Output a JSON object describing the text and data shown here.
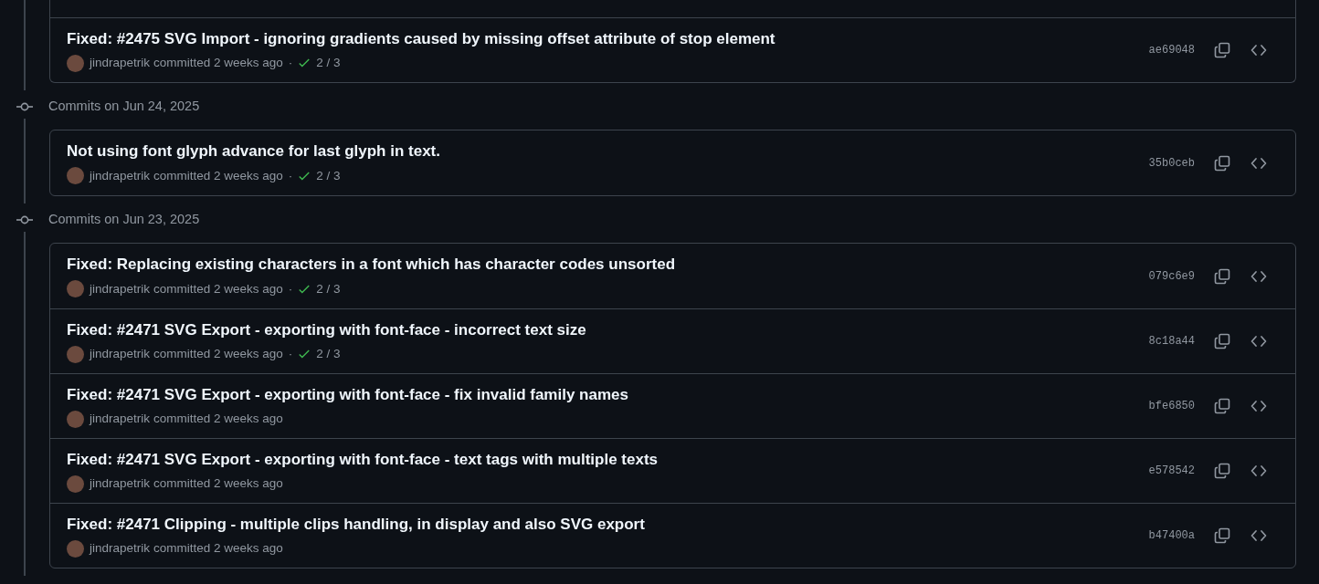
{
  "groups": [
    {
      "commits": [
        {
          "title": "Fixed: #2475 SVG Import - ignoring gradients caused by missing offset attribute of stop element",
          "author": "jindrapetrik",
          "action": "committed 2 weeks ago",
          "separator": "·",
          "checks": "2 / 3",
          "hash": "ae69048"
        }
      ]
    },
    {
      "date": "Commits on Jun 24, 2025",
      "commits": [
        {
          "title": "Not using font glyph advance for last glyph in text.",
          "author": "jindrapetrik",
          "action": "committed 2 weeks ago",
          "separator": "·",
          "checks": "2 / 3",
          "hash": "35b0ceb"
        }
      ]
    },
    {
      "date": "Commits on Jun 23, 2025",
      "commits": [
        {
          "title": "Fixed: Replacing existing characters in a font which has character codes unsorted",
          "author": "jindrapetrik",
          "action": "committed 2 weeks ago",
          "separator": "·",
          "checks": "2 / 3",
          "hash": "079c6e9"
        },
        {
          "title": "Fixed: #2471 SVG Export - exporting with font-face - incorrect text size",
          "author": "jindrapetrik",
          "action": "committed 2 weeks ago",
          "separator": "·",
          "checks": "2 / 3",
          "hash": "8c18a44"
        },
        {
          "title": "Fixed: #2471 SVG Export - exporting with font-face - fix invalid family names",
          "author": "jindrapetrik",
          "action": "committed 2 weeks ago",
          "hash": "bfe6850"
        },
        {
          "title": "Fixed: #2471 SVG Export - exporting with font-face - text tags with multiple texts",
          "author": "jindrapetrik",
          "action": "committed 2 weeks ago",
          "hash": "e578542"
        },
        {
          "title": "Fixed: #2471 Clipping - multiple clips handling, in display and also SVG export",
          "author": "jindrapetrik",
          "action": "committed 2 weeks ago",
          "hash": "b47400a"
        }
      ]
    }
  ]
}
